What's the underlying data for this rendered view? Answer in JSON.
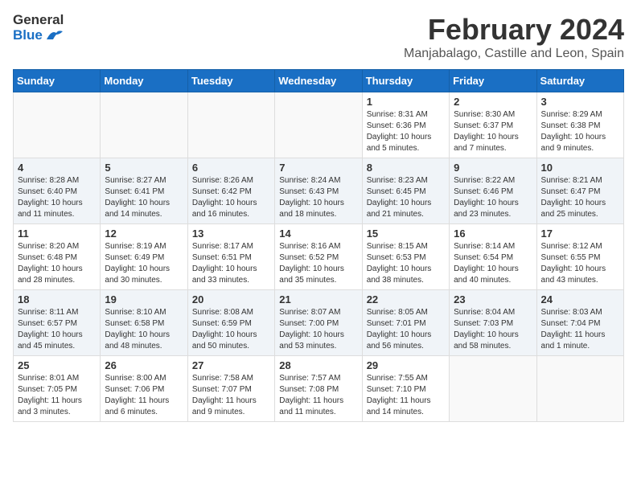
{
  "logo": {
    "general": "General",
    "blue": "Blue"
  },
  "title": "February 2024",
  "subtitle": "Manjabalago, Castille and Leon, Spain",
  "weekdays": [
    "Sunday",
    "Monday",
    "Tuesday",
    "Wednesday",
    "Thursday",
    "Friday",
    "Saturday"
  ],
  "weeks": [
    {
      "shaded": false,
      "days": [
        {
          "num": "",
          "info": ""
        },
        {
          "num": "",
          "info": ""
        },
        {
          "num": "",
          "info": ""
        },
        {
          "num": "",
          "info": ""
        },
        {
          "num": "1",
          "info": "Sunrise: 8:31 AM\nSunset: 6:36 PM\nDaylight: 10 hours\nand 5 minutes."
        },
        {
          "num": "2",
          "info": "Sunrise: 8:30 AM\nSunset: 6:37 PM\nDaylight: 10 hours\nand 7 minutes."
        },
        {
          "num": "3",
          "info": "Sunrise: 8:29 AM\nSunset: 6:38 PM\nDaylight: 10 hours\nand 9 minutes."
        }
      ]
    },
    {
      "shaded": true,
      "days": [
        {
          "num": "4",
          "info": "Sunrise: 8:28 AM\nSunset: 6:40 PM\nDaylight: 10 hours\nand 11 minutes."
        },
        {
          "num": "5",
          "info": "Sunrise: 8:27 AM\nSunset: 6:41 PM\nDaylight: 10 hours\nand 14 minutes."
        },
        {
          "num": "6",
          "info": "Sunrise: 8:26 AM\nSunset: 6:42 PM\nDaylight: 10 hours\nand 16 minutes."
        },
        {
          "num": "7",
          "info": "Sunrise: 8:24 AM\nSunset: 6:43 PM\nDaylight: 10 hours\nand 18 minutes."
        },
        {
          "num": "8",
          "info": "Sunrise: 8:23 AM\nSunset: 6:45 PM\nDaylight: 10 hours\nand 21 minutes."
        },
        {
          "num": "9",
          "info": "Sunrise: 8:22 AM\nSunset: 6:46 PM\nDaylight: 10 hours\nand 23 minutes."
        },
        {
          "num": "10",
          "info": "Sunrise: 8:21 AM\nSunset: 6:47 PM\nDaylight: 10 hours\nand 25 minutes."
        }
      ]
    },
    {
      "shaded": false,
      "days": [
        {
          "num": "11",
          "info": "Sunrise: 8:20 AM\nSunset: 6:48 PM\nDaylight: 10 hours\nand 28 minutes."
        },
        {
          "num": "12",
          "info": "Sunrise: 8:19 AM\nSunset: 6:49 PM\nDaylight: 10 hours\nand 30 minutes."
        },
        {
          "num": "13",
          "info": "Sunrise: 8:17 AM\nSunset: 6:51 PM\nDaylight: 10 hours\nand 33 minutes."
        },
        {
          "num": "14",
          "info": "Sunrise: 8:16 AM\nSunset: 6:52 PM\nDaylight: 10 hours\nand 35 minutes."
        },
        {
          "num": "15",
          "info": "Sunrise: 8:15 AM\nSunset: 6:53 PM\nDaylight: 10 hours\nand 38 minutes."
        },
        {
          "num": "16",
          "info": "Sunrise: 8:14 AM\nSunset: 6:54 PM\nDaylight: 10 hours\nand 40 minutes."
        },
        {
          "num": "17",
          "info": "Sunrise: 8:12 AM\nSunset: 6:55 PM\nDaylight: 10 hours\nand 43 minutes."
        }
      ]
    },
    {
      "shaded": true,
      "days": [
        {
          "num": "18",
          "info": "Sunrise: 8:11 AM\nSunset: 6:57 PM\nDaylight: 10 hours\nand 45 minutes."
        },
        {
          "num": "19",
          "info": "Sunrise: 8:10 AM\nSunset: 6:58 PM\nDaylight: 10 hours\nand 48 minutes."
        },
        {
          "num": "20",
          "info": "Sunrise: 8:08 AM\nSunset: 6:59 PM\nDaylight: 10 hours\nand 50 minutes."
        },
        {
          "num": "21",
          "info": "Sunrise: 8:07 AM\nSunset: 7:00 PM\nDaylight: 10 hours\nand 53 minutes."
        },
        {
          "num": "22",
          "info": "Sunrise: 8:05 AM\nSunset: 7:01 PM\nDaylight: 10 hours\nand 56 minutes."
        },
        {
          "num": "23",
          "info": "Sunrise: 8:04 AM\nSunset: 7:03 PM\nDaylight: 10 hours\nand 58 minutes."
        },
        {
          "num": "24",
          "info": "Sunrise: 8:03 AM\nSunset: 7:04 PM\nDaylight: 11 hours\nand 1 minute."
        }
      ]
    },
    {
      "shaded": false,
      "days": [
        {
          "num": "25",
          "info": "Sunrise: 8:01 AM\nSunset: 7:05 PM\nDaylight: 11 hours\nand 3 minutes."
        },
        {
          "num": "26",
          "info": "Sunrise: 8:00 AM\nSunset: 7:06 PM\nDaylight: 11 hours\nand 6 minutes."
        },
        {
          "num": "27",
          "info": "Sunrise: 7:58 AM\nSunset: 7:07 PM\nDaylight: 11 hours\nand 9 minutes."
        },
        {
          "num": "28",
          "info": "Sunrise: 7:57 AM\nSunset: 7:08 PM\nDaylight: 11 hours\nand 11 minutes."
        },
        {
          "num": "29",
          "info": "Sunrise: 7:55 AM\nSunset: 7:10 PM\nDaylight: 11 hours\nand 14 minutes."
        },
        {
          "num": "",
          "info": ""
        },
        {
          "num": "",
          "info": ""
        }
      ]
    }
  ]
}
